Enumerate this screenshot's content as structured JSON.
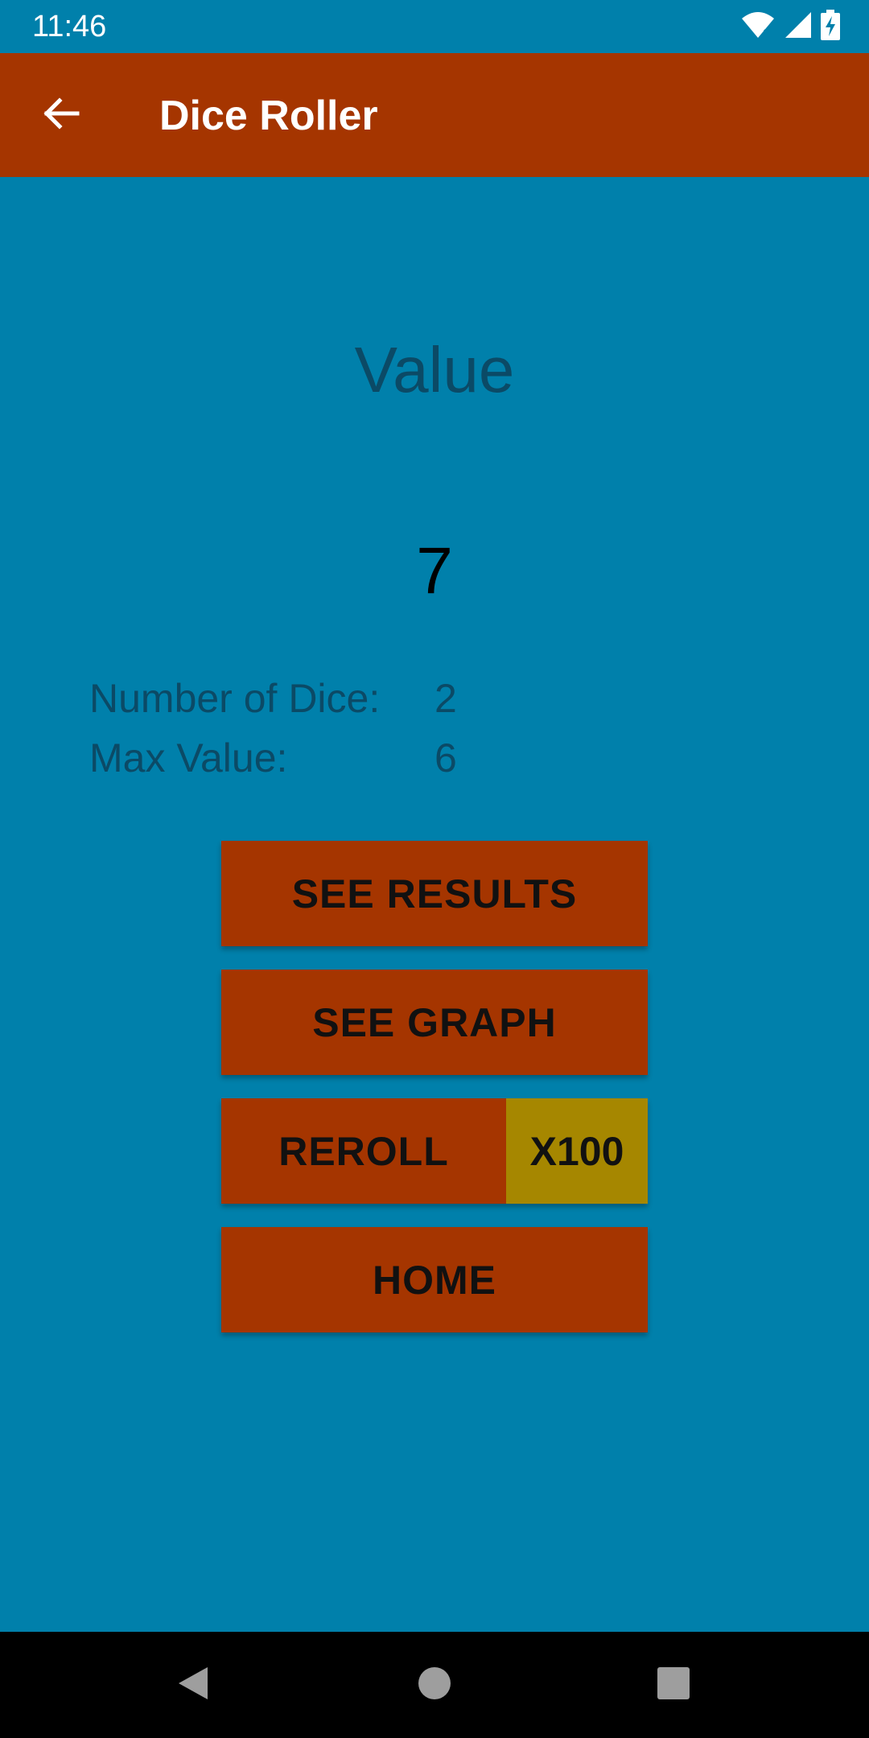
{
  "status_bar": {
    "time": "11:46",
    "icons": [
      "wifi-icon",
      "signal-icon",
      "battery-charging-icon"
    ]
  },
  "app_bar": {
    "back_icon": "arrow-back-icon",
    "title": "Dice Roller"
  },
  "main": {
    "heading": "Value",
    "value": "7",
    "info": [
      {
        "label": "Number of Dice:",
        "value": "2"
      },
      {
        "label": "Max Value:",
        "value": "6"
      }
    ]
  },
  "buttons": {
    "see_results": "SEE RESULTS",
    "see_graph": "SEE GRAPH",
    "reroll": "REROLL",
    "x100": "X100",
    "home": "HOME"
  },
  "nav_bar": {
    "icons": [
      "nav-back-icon",
      "nav-home-icon",
      "nav-recents-icon"
    ]
  },
  "colors": {
    "background": "#0080AB",
    "app_bar": "#A53500",
    "button": "#A53500",
    "x100_button": "#A68700",
    "muted_text": "#0B4A66"
  }
}
